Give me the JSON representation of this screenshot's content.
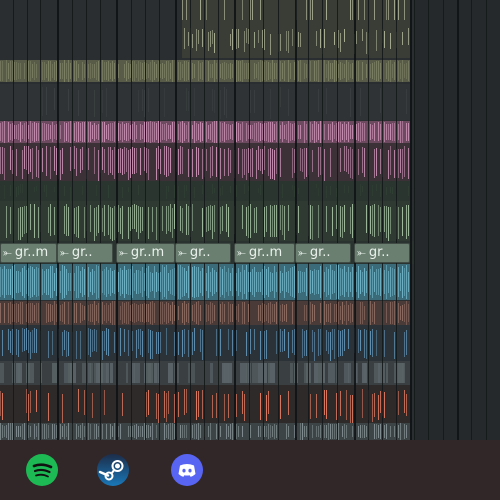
{
  "app": {
    "name": "DAW playlist",
    "colors": {
      "background": "#2a2e30",
      "grid": "#14181a",
      "track_tan": "#a7ad93",
      "track_olive": "#7b7f63",
      "track_pink": "#c58db0",
      "track_green": "#9fba9c",
      "track_blue": "#6fb3c6",
      "track_brown": "#8c6b61",
      "track_steel": "#5f8fb0",
      "track_salmon": "#e07a63",
      "taskbar": "#322728"
    }
  },
  "pattern_clips": [
    {
      "label": "gr..m",
      "icon": "arrow-right-icon"
    },
    {
      "label": "gr..",
      "icon": "arrow-right-icon"
    },
    {
      "label": "gr..m",
      "icon": "arrow-right-icon"
    },
    {
      "label": "gr..",
      "icon": "arrow-right-icon"
    },
    {
      "label": "gr..m",
      "icon": "arrow-right-icon"
    },
    {
      "label": "gr..",
      "icon": "arrow-right-icon"
    },
    {
      "label": "gr..",
      "icon": "arrow-right-icon"
    }
  ],
  "taskbar": {
    "apps": [
      {
        "name": "Spotify",
        "icon": "spotify-icon",
        "color": "#1db954"
      },
      {
        "name": "Steam",
        "icon": "steam-icon",
        "color": "#1b3f6e"
      },
      {
        "name": "Discord",
        "icon": "discord-icon",
        "color": "#5865f2"
      }
    ]
  }
}
